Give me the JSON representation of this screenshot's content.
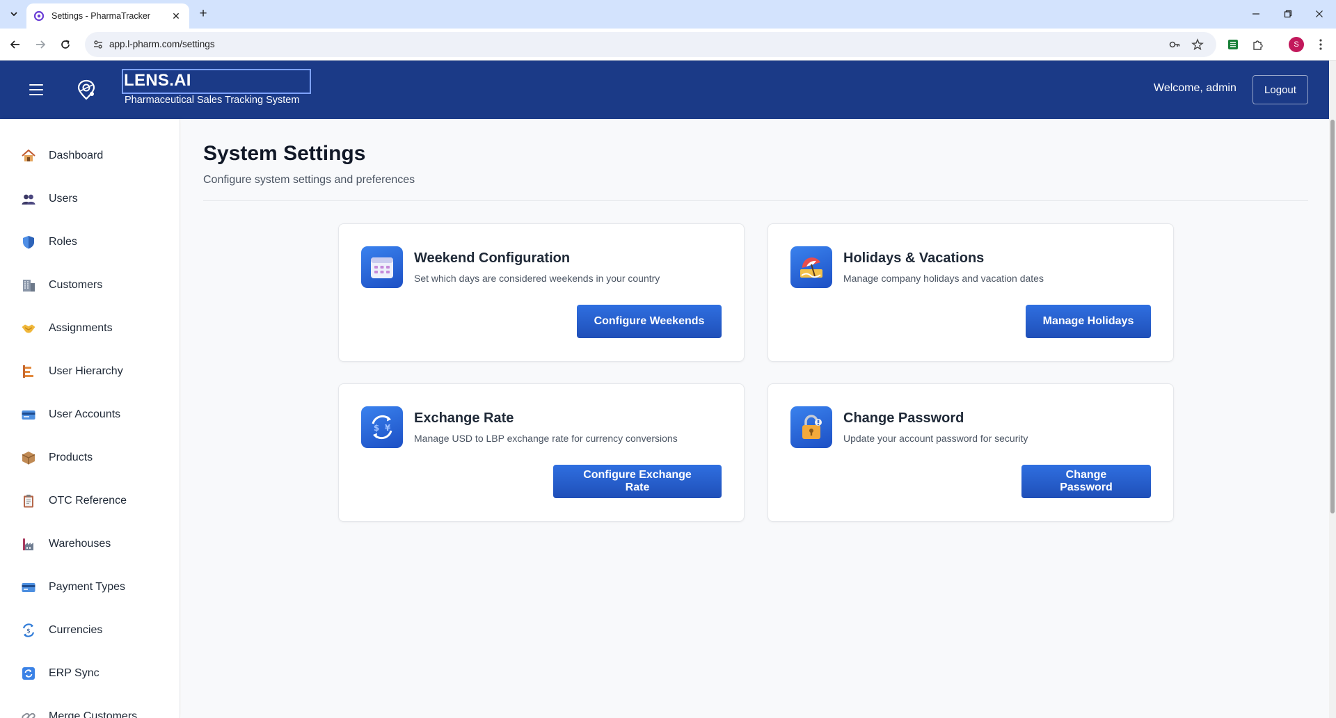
{
  "browser": {
    "tab_title": "Settings - PharmaTracker",
    "url": "app.l-pharm.com/settings",
    "profile_initial": "S"
  },
  "header": {
    "brand_name": "LENS.AI",
    "brand_subtitle": "Pharmaceutical Sales Tracking System",
    "welcome": "Welcome, admin",
    "logout_label": "Logout",
    "bg_color": "#1b3a87"
  },
  "sidebar": {
    "items": [
      {
        "label": "Dashboard",
        "icon": "house-icon"
      },
      {
        "label": "Users",
        "icon": "users-icon"
      },
      {
        "label": "Roles",
        "icon": "shield-icon"
      },
      {
        "label": "Customers",
        "icon": "building-icon"
      },
      {
        "label": "Assignments",
        "icon": "handshake-icon"
      },
      {
        "label": "User Hierarchy",
        "icon": "hierarchy-icon"
      },
      {
        "label": "User Accounts",
        "icon": "id-card-icon"
      },
      {
        "label": "Products",
        "icon": "package-icon"
      },
      {
        "label": "OTC Reference",
        "icon": "clipboard-icon"
      },
      {
        "label": "Warehouses",
        "icon": "factory-icon"
      },
      {
        "label": "Payment Types",
        "icon": "credit-card-icon"
      },
      {
        "label": "Currencies",
        "icon": "currency-exchange-icon"
      },
      {
        "label": "ERP Sync",
        "icon": "sync-icon"
      },
      {
        "label": "Merge Customers",
        "icon": "link-icon"
      }
    ]
  },
  "main": {
    "title": "System Settings",
    "subtitle": "Configure system settings and preferences",
    "cards": [
      {
        "title": "Weekend Configuration",
        "description": "Set which days are considered weekends in your country",
        "button": "Configure Weekends",
        "icon": "calendar-icon"
      },
      {
        "title": "Holidays & Vacations",
        "description": "Manage company holidays and vacation dates",
        "button": "Manage Holidays",
        "icon": "beach-umbrella-icon"
      },
      {
        "title": "Exchange Rate",
        "description": "Manage USD to LBP exchange rate for currency conversions",
        "button": "Configure Exchange Rate",
        "icon": "currency-exchange-icon"
      },
      {
        "title": "Change Password",
        "description": "Update your account password for security",
        "button": "Change Password",
        "icon": "lock-icon"
      }
    ]
  }
}
